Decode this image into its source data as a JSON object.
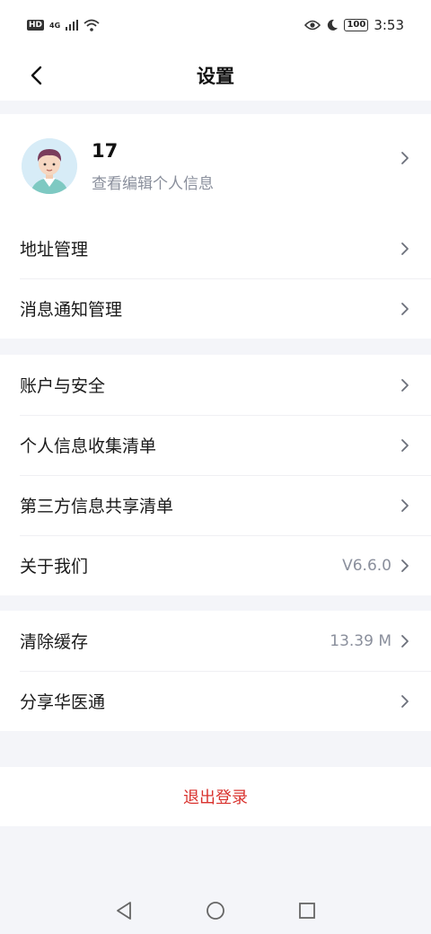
{
  "status_bar": {
    "hd": "HD",
    "network": "4G",
    "battery": "100",
    "time": "3:53"
  },
  "header": {
    "title": "设置"
  },
  "profile": {
    "name": "17",
    "subtitle": "查看编辑个人信息"
  },
  "group1": [
    {
      "label": "地址管理",
      "value": ""
    },
    {
      "label": "消息通知管理",
      "value": ""
    }
  ],
  "group2": [
    {
      "label": "账户与安全",
      "value": ""
    },
    {
      "label": "个人信息收集清单",
      "value": ""
    },
    {
      "label": "第三方信息共享清单",
      "value": ""
    },
    {
      "label": "关于我们",
      "value": "V6.6.0"
    }
  ],
  "group3": [
    {
      "label": "清除缓存",
      "value": "13.39 M"
    },
    {
      "label": "分享华医通",
      "value": ""
    }
  ],
  "logout": {
    "label": "退出登录"
  },
  "colors": {
    "background": "#f4f5f9",
    "card": "#ffffff",
    "logout_text": "#d9322e",
    "secondary_text": "#8a8f9c"
  },
  "icons": [
    "back-arrow-icon",
    "chevron-right-icon",
    "eye-icon",
    "moon-icon",
    "wifi-icon",
    "signal-icon",
    "triangle-back-icon",
    "circle-home-icon",
    "square-recent-icon"
  ]
}
